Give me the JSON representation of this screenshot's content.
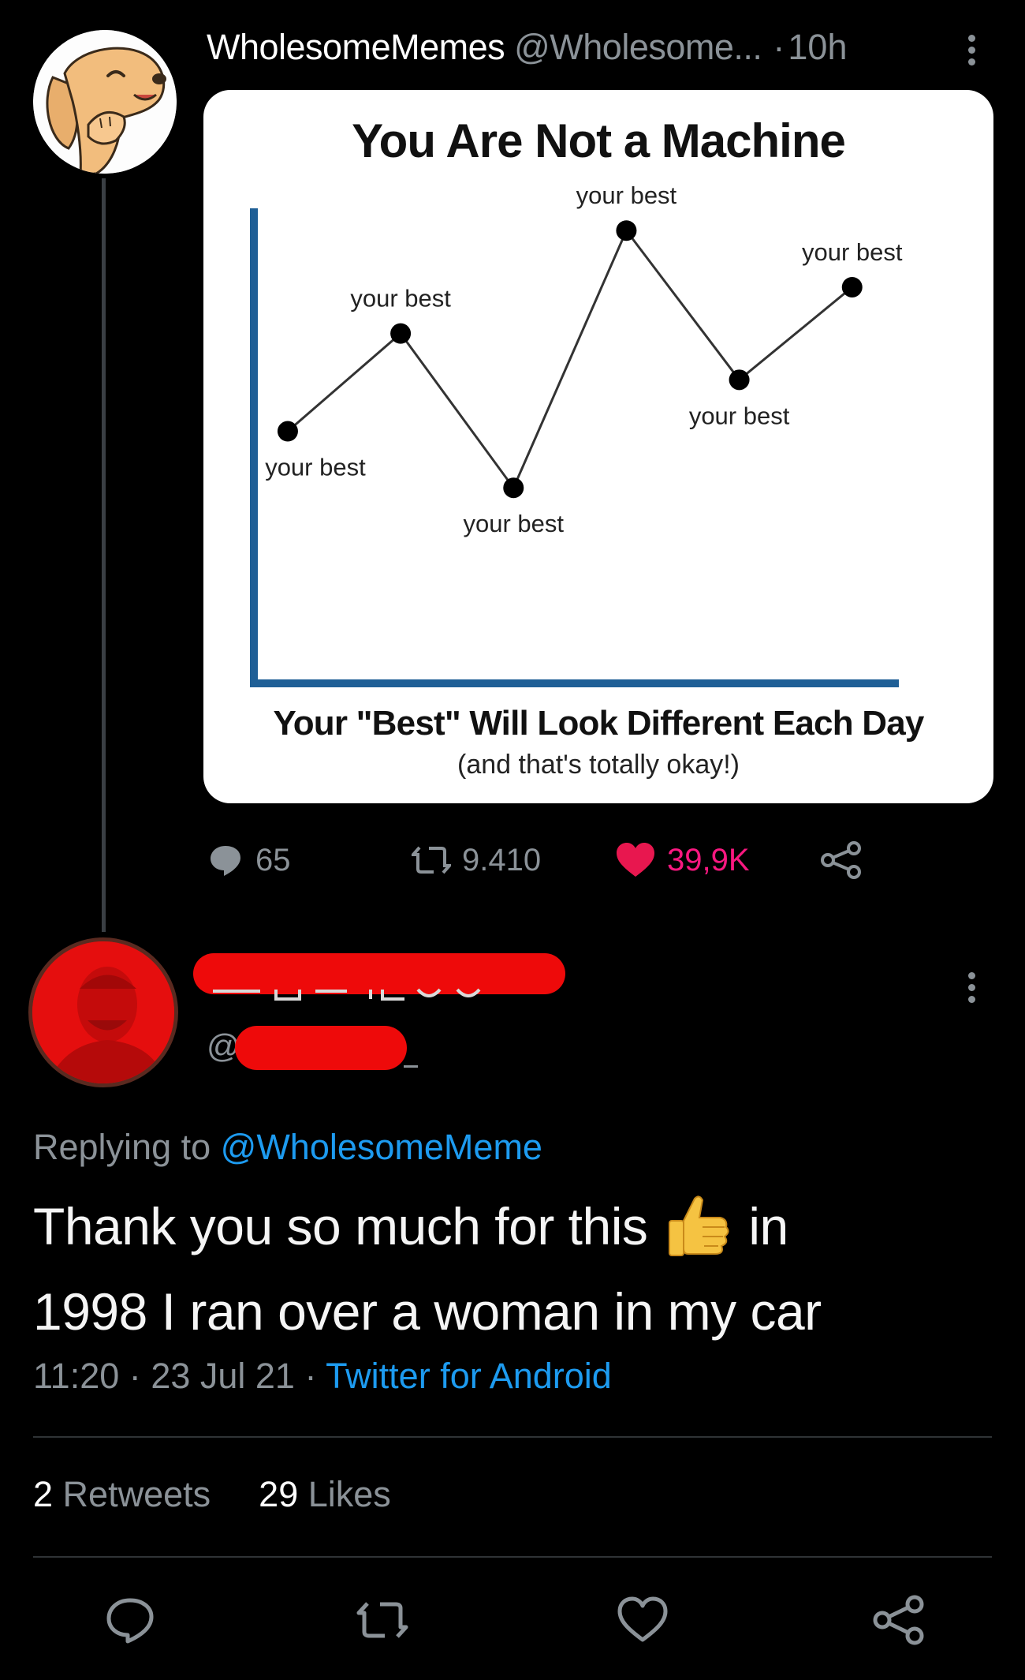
{
  "tweet": {
    "display_name": "WholesomeMemes",
    "handle": "@Wholesome...",
    "separator": "·",
    "time_ago": "10h",
    "image": {
      "title": "You Are Not a Machine",
      "subtitle": "Your \"Best\" Will Look Different Each Day",
      "caption": "(and that's totally okay!)",
      "point_label": "your best"
    },
    "stats": {
      "replies": "65",
      "retweets": "9.410",
      "likes": "39,9K"
    }
  },
  "chart_data": {
    "type": "line",
    "title": "You Are Not a Machine",
    "xlabel": "",
    "ylabel": "",
    "grid": false,
    "x": [
      1,
      2,
      3,
      4,
      5,
      6
    ],
    "series": [
      {
        "values": [
          4.9,
          6.8,
          3.8,
          8.8,
          5.9,
          7.7
        ]
      }
    ],
    "point_labels": [
      "your best",
      "your best",
      "your best",
      "your best",
      "your best",
      "your best"
    ],
    "colors": {
      "axis": "#1f5f96",
      "line": "#333333",
      "point": "#000000"
    }
  },
  "reply": {
    "replying_prefix": "Replying to",
    "replying_to": "@WholesomeMeme",
    "text_part1": "Thank you so much for this",
    "text_part2": "in",
    "text_part3": "1998 I ran over a woman in my car",
    "time": "11:20",
    "date": "23 Jul 21",
    "dot": "·",
    "client": "Twitter for Android",
    "retweets_count": "2",
    "retweets_label": "Retweets",
    "likes_count": "29",
    "likes_label": "Likes",
    "handle_prefix": "@"
  },
  "icons": {
    "reply": "comment-icon",
    "retweet": "retweet-icon",
    "like": "heart-icon",
    "share": "share-icon",
    "emoji": "thumbs-up-emoji"
  },
  "colors": {
    "background": "#000000",
    "muted": "#8b9298",
    "link": "#1d9bf0",
    "like": "#f91880",
    "redaction": "#ee0a0a"
  }
}
